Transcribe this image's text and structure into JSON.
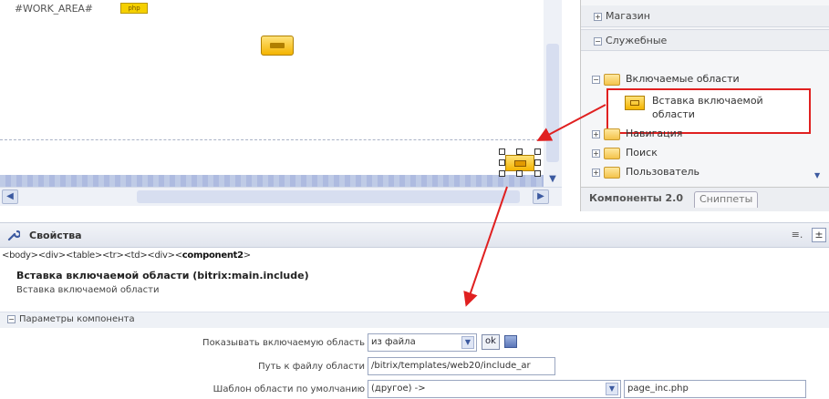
{
  "work_area": {
    "label": "#WORK_AREA#",
    "php_badge": "php"
  },
  "right_panel": {
    "items": [
      {
        "label": "Магазин",
        "expanded": false
      },
      {
        "label": "Служебные",
        "expanded": true
      }
    ],
    "folder_included": "Включаемые области",
    "include_item": "Вставка включаемой области",
    "folders": [
      "Навигация",
      "Поиск",
      "Пользователь"
    ],
    "tabs": {
      "components": "Компоненты 2.0",
      "snippets": "Сниппеты"
    }
  },
  "properties": {
    "title": "Свойства",
    "breadcrumb_prefix": "<body><div><table><tr><td><div><",
    "breadcrumb_component": "component2",
    "breadcrumb_suffix": ">",
    "component_title": "Вставка включаемой области (bitrix:main.include)",
    "component_desc": "Вставка включаемой области",
    "params_section": "Параметры компонента",
    "params": [
      {
        "label": "Показывать включаемую область",
        "value": "из файла",
        "has_ok": true,
        "ok_label": "ok"
      },
      {
        "label": "Путь к файлу области",
        "value": "/bitrix/templates/web20/include_ar"
      },
      {
        "label": "Шаблон области по умолчанию",
        "value": "(другое) ->",
        "extra_value": "page_inc.php"
      }
    ]
  },
  "colors": {
    "highlight_red": "#e02020",
    "component_yellow": "#f4b400",
    "panel_blue": "#dde4f2"
  }
}
